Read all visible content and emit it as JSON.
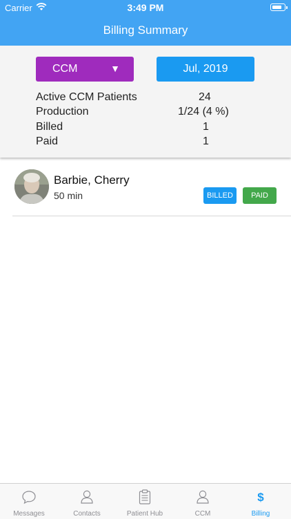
{
  "status_bar": {
    "carrier": "Carrier",
    "time": "3:49 PM"
  },
  "header": {
    "title": "Billing Summary"
  },
  "filters": {
    "program": "CCM",
    "month": "Jul, 2019"
  },
  "stats": [
    {
      "label": "Active CCM Patients",
      "value": "24"
    },
    {
      "label": "Production",
      "value": "1/24 (4 %)"
    },
    {
      "label": "Billed",
      "value": "1"
    },
    {
      "label": "Paid",
      "value": "1"
    }
  ],
  "patients": [
    {
      "name": "Barbie, Cherry",
      "duration": "50 min",
      "badges": [
        "BILLED",
        "PAID"
      ]
    }
  ],
  "tabs": [
    {
      "label": "Messages",
      "icon": "chat-bubble-icon"
    },
    {
      "label": "Contacts",
      "icon": "person-icon"
    },
    {
      "label": "Patient Hub",
      "icon": "clipboard-icon"
    },
    {
      "label": "CCM",
      "icon": "person-icon"
    },
    {
      "label": "Billing",
      "icon": "dollar-icon",
      "active": true
    }
  ],
  "colors": {
    "header": "#42a4f3",
    "program_button": "#9f2bbd",
    "month_button": "#1a9af1",
    "billed_badge": "#1a9af1",
    "paid_badge": "#43a84b",
    "active_tab": "#1a9af1"
  }
}
